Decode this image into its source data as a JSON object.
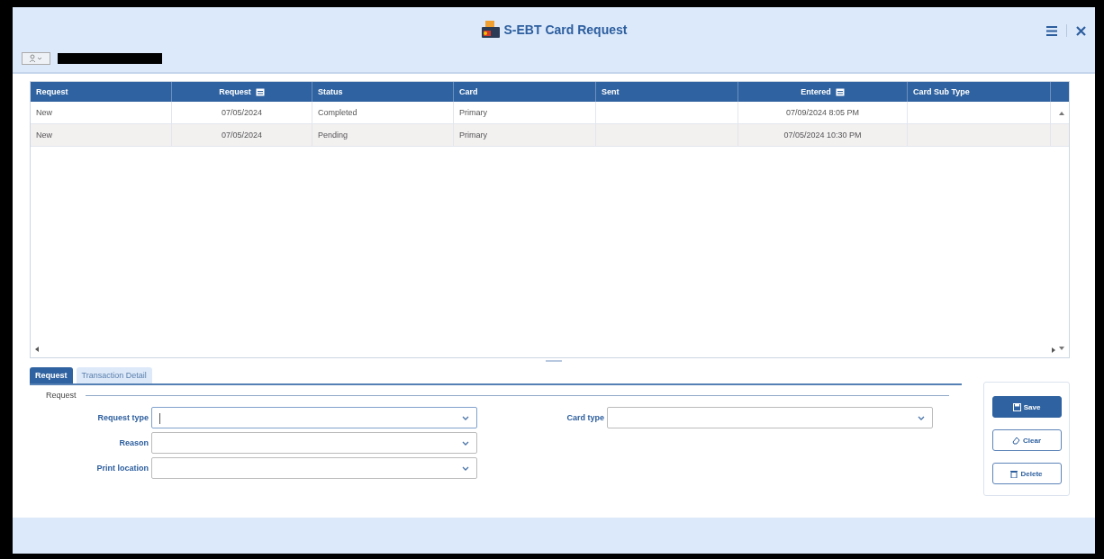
{
  "window": {
    "title": "S-EBT Card Request"
  },
  "table": {
    "columns": [
      {
        "label": "Request",
        "date": false
      },
      {
        "label": "Request",
        "date": true
      },
      {
        "label": "Status",
        "date": false
      },
      {
        "label": "Card",
        "date": false
      },
      {
        "label": "Sent",
        "date": false
      },
      {
        "label": "Entered",
        "date": true
      },
      {
        "label": "Card Sub Type",
        "date": false
      }
    ],
    "rows": [
      [
        "New",
        "07/05/2024",
        "Completed",
        "Primary",
        "",
        "07/09/2024 8:05 PM",
        ""
      ],
      [
        "New",
        "07/05/2024",
        "Pending",
        "Primary",
        "",
        "07/05/2024 10:30 PM",
        ""
      ]
    ]
  },
  "tabs": [
    {
      "label": "Request",
      "selected": true
    },
    {
      "label": "Transaction Detail",
      "selected": false
    }
  ],
  "section": {
    "title": "Request"
  },
  "fields_left": [
    {
      "label": "Request type",
      "focused": true
    },
    {
      "label": "Reason",
      "focused": false
    },
    {
      "label": "Print location",
      "focused": false
    }
  ],
  "fields_right": [
    {
      "label": "Card type",
      "focused": false
    }
  ],
  "buttons": [
    {
      "label": "Save",
      "kind": "primary"
    },
    {
      "label": "Clear",
      "kind": "secondary"
    },
    {
      "label": "Delete",
      "kind": "secondary"
    }
  ]
}
